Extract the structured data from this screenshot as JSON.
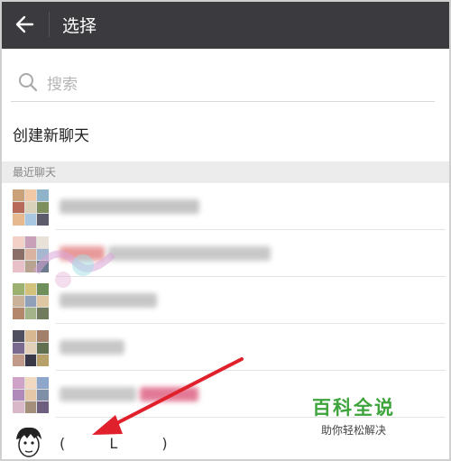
{
  "header": {
    "title": "选择"
  },
  "search": {
    "placeholder": "搜索"
  },
  "new_chat": {
    "label": "创建新聊天"
  },
  "recent": {
    "heading": "最近聊天",
    "partial_name": "( L )"
  },
  "watermark": {
    "title": "百科全说",
    "subtitle": "助你轻松解决"
  },
  "colors": {
    "topbar": "#3a3a3f",
    "watermark_green": "#3da33b",
    "arrow_red": "#e0202a"
  }
}
